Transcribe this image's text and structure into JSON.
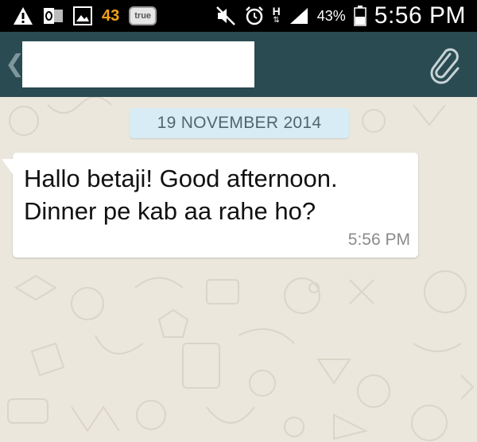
{
  "status_bar": {
    "notification_count": "43",
    "badge_label": "true",
    "network_type": "H",
    "battery_percent": "43%",
    "time": "5:56 PM",
    "icons": [
      "warning-icon",
      "outlook-icon",
      "gallery-icon",
      "true-badge-icon",
      "mute-icon",
      "alarm-icon",
      "network-h-icon",
      "signal-icon",
      "battery-icon"
    ]
  },
  "action_bar": {
    "back_glyph": "❮",
    "icons": [
      "back-icon",
      "attach-icon"
    ],
    "background_color": "#2a4b52"
  },
  "chat": {
    "date_chip": "19 NOVEMBER 2014",
    "messages": [
      {
        "lines": [
          "Hallo betaji! Good afternoon.",
          "Dinner pe kab aa rahe ho?"
        ],
        "time": "5:56 PM"
      }
    ]
  }
}
